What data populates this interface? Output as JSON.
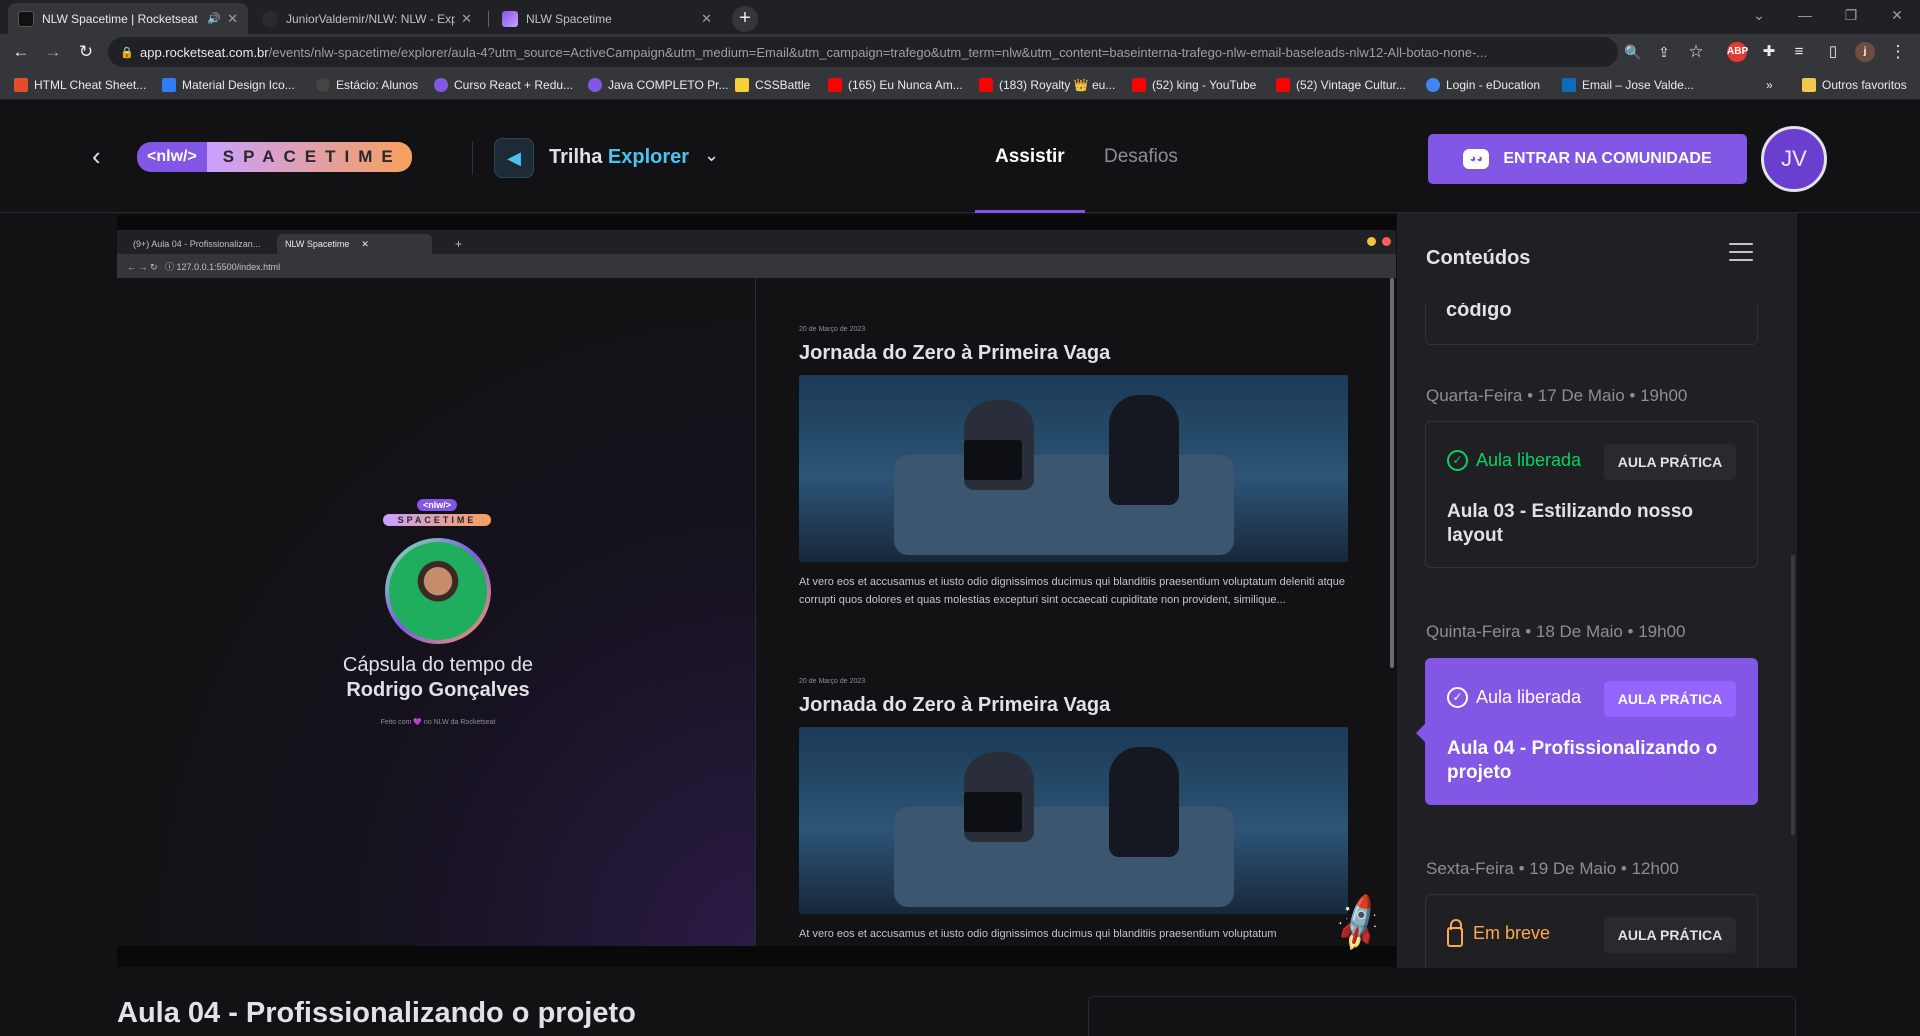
{
  "browser": {
    "tabs": [
      {
        "title": "NLW Spacetime | Rocketseat",
        "active": true
      },
      {
        "title": "JuniorValdemir/NLW: NLW - Expl",
        "active": false
      },
      {
        "title": "NLW Spacetime",
        "active": false
      }
    ],
    "url_host": "app.rocketseat.com.br",
    "url_path": "/events/nlw-spacetime/explorer/aula-4?utm_source=ActiveCampaign&utm_medium=Email&utm_campaign=trafego&utm_term=nlw&utm_content=baseinterna-trafego-nlw-email-baseleads-nlw12-All-botao-none-...",
    "profile_initial": "j",
    "bookmarks": [
      "HTML Cheat Sheet...",
      "Material Design Ico...",
      "Estácio: Alunos",
      "Curso React + Redu...",
      "Java COMPLETO Pr...",
      "CSSBattle",
      "(165) Eu Nunca Am...",
      "(183) Royalty 👑 eu...",
      "(52) king - YouTube",
      "(52) Vintage Cultur...",
      "Login - eDucation",
      "Email – Jose Valde..."
    ],
    "bookmarks_more": "»",
    "other_bookmarks": "Outros favoritos"
  },
  "header": {
    "logo_nlw": "<nlw/>",
    "logo_spacetime": "SPACETIME",
    "trail_prefix": "Trilha",
    "trail_name": "Explorer",
    "nav_watch": "Assistir",
    "nav_challenges": "Desafios",
    "community_button": "ENTRAR NA COMUNIDADE",
    "avatar_initials": "JV"
  },
  "video": {
    "browser_tabs": [
      "(9+) Aula 04 - Profissionalizan...",
      "NLW Spacetime"
    ],
    "browser_url": "127.0.0.1:5500/index.html",
    "logo_nlw": "<nlw/>",
    "logo_spacetime": "SPACETIME",
    "capsule_line1": "Cápsula do tempo de",
    "capsule_line2": "Rodrigo Gonçalves",
    "footer": "Feito com 💜 no NLW da Rocketseat",
    "posts": [
      {
        "date": "20 de Março de 2023",
        "title": "Jornada do Zero à Primeira Vaga",
        "text": "At vero eos et accusamus et iusto odio dignissimos ducimus qui blanditiis praesentium voluptatum deleniti atque corrupti quos dolores et quas molestias excepturi sint occaecati cupiditate non provident, similique..."
      },
      {
        "date": "20 de Março de 2023",
        "title": "Jornada do Zero à Primeira Vaga",
        "text": "At vero eos et accusamus et iusto odio dignissimos ducimus qui blanditiis praesentium voluptatum"
      }
    ]
  },
  "lesson_title": "Aula 04 - Profissionalizando o projeto",
  "sidebar": {
    "title": "Conteúdos",
    "prev_card_title": "código",
    "lessons": [
      {
        "day": "Quarta-Feira • 17 De Maio • 19h00",
        "status": "Aula liberada",
        "tag": "AULA PRÁTICA",
        "name": "Aula 03 - Estilizando nosso layout",
        "state": "released"
      },
      {
        "day": "Quinta-Feira • 18 De Maio • 19h00",
        "status": "Aula liberada",
        "tag": "AULA PRÁTICA",
        "name": "Aula 04 - Profissionalizando o projeto",
        "state": "active"
      },
      {
        "day": "Sexta-Feira • 19 De Maio • 12h00",
        "status": "Em breve",
        "tag": "AULA PRÁTICA",
        "name": "",
        "state": "locked"
      }
    ]
  },
  "colors": {
    "accent": "#8257e5",
    "green": "#04d361",
    "orange": "#fba94c",
    "blue": "#4bc3f0"
  }
}
